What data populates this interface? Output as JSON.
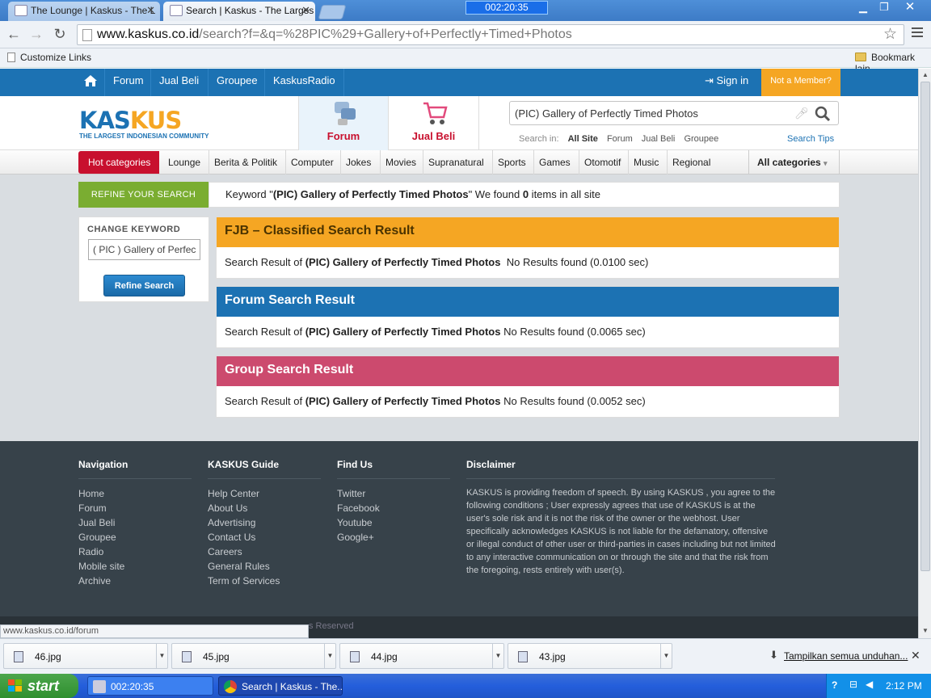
{
  "browser": {
    "tabs": [
      {
        "title": "The Lounge | Kaskus - The L",
        "active": false
      },
      {
        "title": "Search | Kaskus - The Larges",
        "active": true
      }
    ],
    "overlay_timer": "002:20:35",
    "url_domain": "www.kaskus.co.id",
    "url_path": "/search?f=&q=%28PIC%29+Gallery+of+Perfectly+Timed+Photos",
    "bookmarks_left": "Customize Links",
    "bookmarks_right": "Bookmark lain",
    "status_url": "www.kaskus.co.id/forum"
  },
  "site": {
    "topnav": [
      "Forum",
      "Jual Beli",
      "Groupee",
      "KaskusRadio"
    ],
    "sign_in": "Sign in",
    "not_member": "Not a Member?",
    "logo_kas": "KAS",
    "logo_kus": "KUS",
    "logo_tagline": "THE LARGEST INDONESIAN COMMUNITY",
    "forum_label": "Forum",
    "jualbeli_label": "Jual Beli",
    "search_value": "(PIC) Gallery of Perfectly Timed Photos",
    "search_in_label": "Search in:",
    "search_in_options": [
      "All Site",
      "Forum",
      "Jual Beli",
      "Groupee"
    ],
    "search_tips": "Search Tips",
    "hot_categories": "Hot categories",
    "categories": [
      "Lounge",
      "Berita & Politik",
      "Computer",
      "Jokes",
      "Movies",
      "Supranatural",
      "Sports",
      "Games",
      "Otomotif",
      "Music",
      "Regional"
    ],
    "all_categories": "All categories"
  },
  "refine": {
    "label": "REFINE YOUR SEARCH",
    "summary_pre": "Keyword \"",
    "keyword": "(PIC) Gallery of Perfectly Timed Photos",
    "summary_mid": "\" We found ",
    "count": "0",
    "summary_post": " items in all site",
    "change_keyword": "CHANGE KEYWORD",
    "input_value": "( PIC ) Gallery of Perfectly Timed Photos",
    "button": "Refine Search"
  },
  "results": [
    {
      "title": "FJB – Classified Search Result",
      "color": "#f5a623",
      "prefix": "Search Result of ",
      "keyword": "(PIC) Gallery of Perfectly Timed Photos",
      "status": "  No Results found (0.0100 sec)"
    },
    {
      "title": "Forum Search Result",
      "color": "#1c72b3",
      "prefix": "Search Result of ",
      "keyword": "(PIC) Gallery of Perfectly Timed Photos",
      "status": " No Results found (0.0065 sec)"
    },
    {
      "title": "Group Search Result",
      "color": "#cc4a6e",
      "prefix": "Search Result of ",
      "keyword": "(PIC) Gallery of Perfectly Timed Photos",
      "status": " No Results found (0.0052 sec)"
    }
  ],
  "footer": {
    "nav_title": "Navigation",
    "nav_links": [
      "Home",
      "Forum",
      "Jual Beli",
      "Groupee",
      "Radio",
      "Mobile site",
      "Archive"
    ],
    "guide_title": "KASKUS Guide",
    "guide_links": [
      "Help Center",
      "About Us",
      "Advertising",
      "Contact Us",
      "Careers",
      "General Rules",
      "Term of Services"
    ],
    "find_title": "Find Us",
    "find_links": [
      "Twitter",
      "Facebook",
      "Youtube",
      "Google+"
    ],
    "disclaimer_title": "Disclaimer",
    "disclaimer_text": "KASKUS is providing freedom of speech. By using KASKUS , you agree to the following conditions ; User expressly agrees that use of KASKUS is at the user's sole risk and it is not the risk of the owner or the webhost. User specifically acknowledges KASKUS is not liable for the defamatory, offensive or illegal conduct of other user or third-parties in cases including but not limited to any interactive communication on or through the site and that the risk from the foregoing, rests entirely with user(s).",
    "copyright_fragment": "s Reserved"
  },
  "downloads": {
    "items": [
      "46.jpg",
      "45.jpg",
      "44.jpg",
      "43.jpg"
    ],
    "show_all": "Tampilkan semua unduhan..."
  },
  "taskbar": {
    "start": "start",
    "tasks": [
      "002:20:35",
      "Search | Kaskus - The..."
    ],
    "time": "2:12 PM"
  }
}
